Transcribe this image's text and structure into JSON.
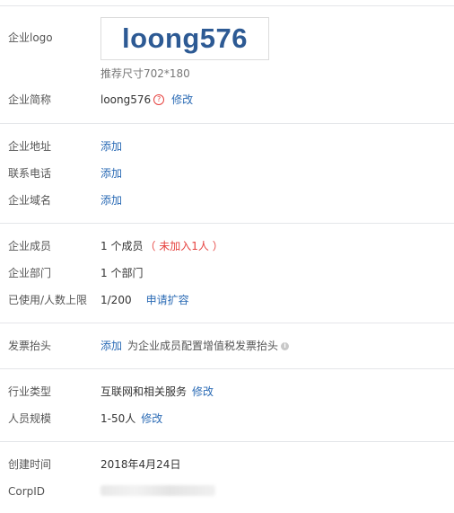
{
  "company": {
    "logo_label": "企业logo",
    "logo_text": "loong576",
    "logo_hint": "推荐尺寸702*180",
    "short_name_label": "企业简称",
    "short_name": "loong576",
    "edit_label": "修改"
  },
  "contact": {
    "address_label": "企业地址",
    "phone_label": "联系电话",
    "domain_label": "企业域名",
    "add_label": "添加"
  },
  "members": {
    "members_label": "企业成员",
    "members_value": "1 个成员",
    "not_joined": "（ 未加入1人 ）",
    "departments_label": "企业部门",
    "departments_value": "1 个部门",
    "usage_label": "已使用/人数上限",
    "usage_value": "1/200",
    "expand_label": "申请扩容"
  },
  "invoice": {
    "label": "发票抬头",
    "add_label": "添加",
    "hint": "为企业成员配置增值税发票抬头"
  },
  "industry": {
    "type_label": "行业类型",
    "type_value": "互联网和相关服务",
    "type_edit": "修改",
    "scale_label": "人员规模",
    "scale_value": "1-50人",
    "scale_edit": "修改"
  },
  "meta": {
    "created_label": "创建时间",
    "created_value": "2018年4月24日",
    "corpid_label": "CorpID"
  },
  "colors": {
    "link": "#2b6bb5",
    "warning": "#e64340",
    "logo": "#2d5a94"
  },
  "icons": {
    "help": "question-circle-icon",
    "info": "info-circle-icon"
  }
}
